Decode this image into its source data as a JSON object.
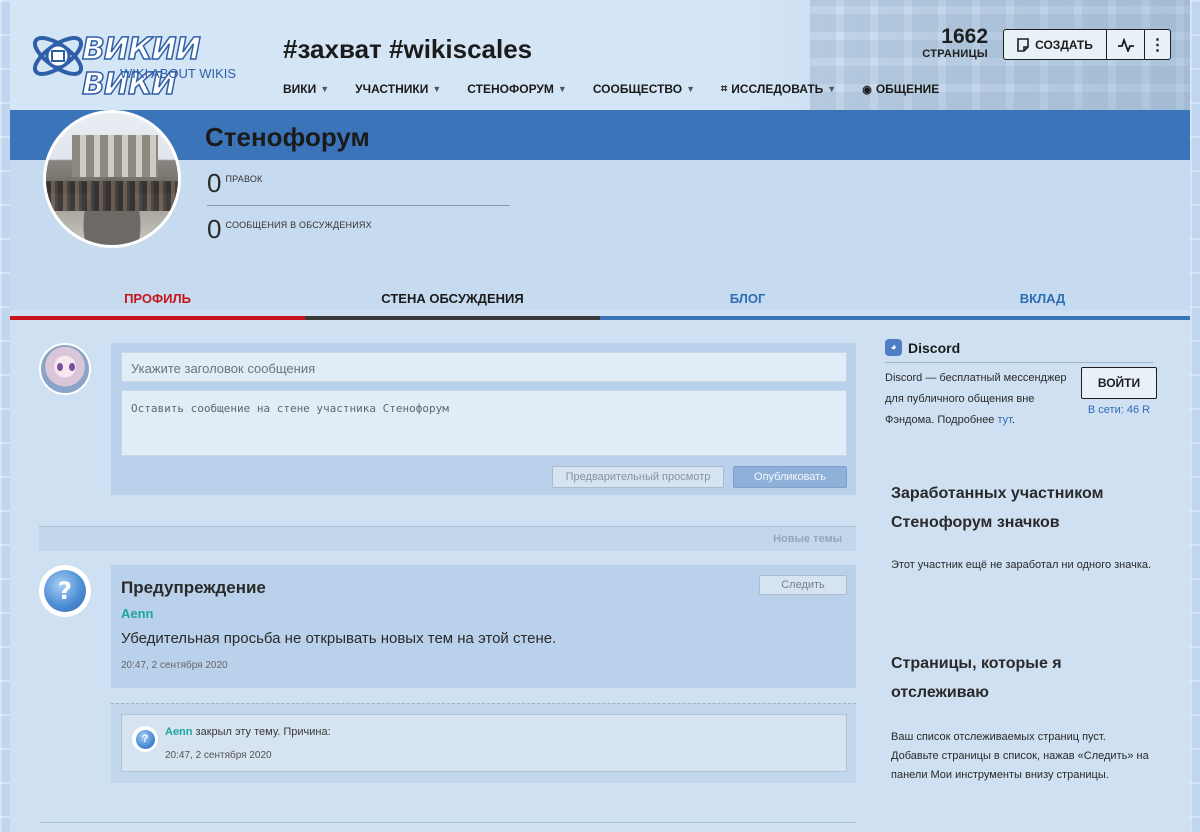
{
  "colors": {
    "accent_blue": "#3b74b9",
    "tab_active_red": "#c7151b",
    "link_teal": "#1ea5a0",
    "link_blue": "#2f6db5"
  },
  "header": {
    "logo": {
      "title": "ВИКИИ ВИКИ",
      "subtitle": "WIKI ABOUT WIKIS"
    },
    "wiki_name": "#захват #wikiscales",
    "nav": [
      {
        "label": "ВИКИ",
        "dropdown": true
      },
      {
        "label": "УЧАСТНИКИ",
        "dropdown": true
      },
      {
        "label": "СТЕНОФОРУМ",
        "dropdown": true
      },
      {
        "label": "СООБЩЕСТВО",
        "dropdown": true
      },
      {
        "label": "ИССЛЕДОВАТЬ",
        "dropdown": true,
        "icon": "explore-icon"
      },
      {
        "label": "ОБЩЕНИЕ",
        "dropdown": false,
        "icon": "chat-icon"
      }
    ],
    "pages_count": "1662",
    "pages_label": "СТРАНИЦЫ",
    "create_label": "СОЗДАТЬ"
  },
  "profile": {
    "username": "Стенофорум",
    "edits_count": "0",
    "edits_label": "ПРАВОК",
    "posts_count": "0",
    "posts_label": "СООБЩЕНИЯ В ОБСУЖДЕНИЯХ"
  },
  "tabs": [
    "ПРОФИЛЬ",
    "СТЕНА ОБСУЖДЕНИЯ",
    "БЛОГ",
    "ВКЛАД"
  ],
  "compose": {
    "title_placeholder": "Укажите заголовок сообщения",
    "body_placeholder": "Оставить сообщение на стене участника Стенофорум",
    "preview_label": "Предварительный просмотр",
    "publish_label": "Опубликовать"
  },
  "new_topics_label": "Новые темы",
  "thread": {
    "title": "Предупреждение",
    "follow_label": "Следить",
    "author": "Aenn",
    "text": "Убедительная просьба не открывать новых тем на этой стене.",
    "timestamp": "20:47, 2 сентября 2020",
    "reply": {
      "author": "Aenn",
      "action": " закрыл эту тему. Причина:",
      "timestamp": "20:47, 2 сентября 2020"
    }
  },
  "rail": {
    "discord": {
      "title": "Discord",
      "description": "Discord — бесплатный мессенджер для публичного общения вне Фэндома. Подробнее ",
      "link_text": "тут",
      "after_link": ".",
      "join_label": "ВОЙТИ",
      "online": "В сети: 46 R"
    },
    "badges_heading": "Заработанных участником Стенофорум значков",
    "badges_text": "Этот участник ещё не заработал ни одного значка.",
    "watchlist_heading": "Страницы, которые я отслеживаю",
    "watchlist_text": "Ваш список отслеживаемых страниц пуст. Добавьте страницы в список, нажав «Следить» на панели Мои инструменты внизу страницы."
  }
}
